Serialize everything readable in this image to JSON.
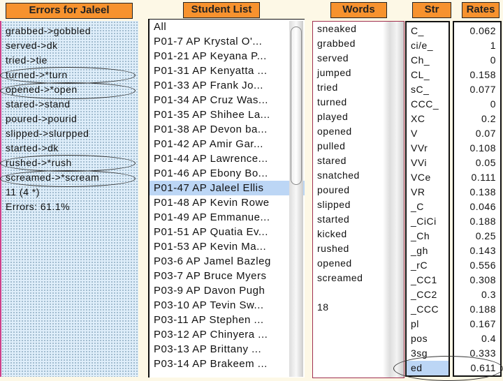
{
  "errors": {
    "title": "Errors for Jaleel",
    "lines": [
      "grabbed->gobbled",
      "served->dk",
      "tried->tie",
      "turned->*turn",
      "opened->*open",
      "stared->stand",
      "poured->pourid",
      "slipped->slurpped",
      "started->dk",
      "rushed->*rush",
      "screamed->*scream",
      "11 (4 *)",
      "Errors: 61.1%"
    ]
  },
  "students": {
    "title": "Student List",
    "selected": "P01-47 AP Jaleel Ellis",
    "items": [
      "All",
      "P01-7 AP Krystal O'...",
      "P01-21 AP Keyana P...",
      "P01-31 AP Kenyatta ...",
      "P01-33 AP Frank Jo...",
      "P01-34 AP Cruz Was...",
      "P01-35 AP Shihee La...",
      "P01-38 AP Devon ba...",
      "P01-42 AP Amir Gar...",
      "P01-44 AP Lawrence...",
      "P01-46 AP Ebony Bo...",
      "P01-47 AP Jaleel Ellis",
      "P01-48 AP Kevin Rowe",
      "P01-49 AP Emmanue...",
      "P01-51 AP Quatia Ev...",
      "P01-53 AP Kevin Ma...",
      "P03-6 AP Jamel Bazleg",
      "P03-7 AP Bruce Myers",
      "P03-9 AP Davon Pugh",
      "P03-10 AP Tevin Sw...",
      "P03-11 AP Stephen ...",
      "P03-12 AP Chinyera ...",
      "P03-13 AP Brittany ...",
      "P03-14 AP Brakeem ..."
    ]
  },
  "words": {
    "title": "Words",
    "items": [
      "sneaked",
      "grabbed",
      "served",
      "jumped",
      "tried",
      "turned",
      "played",
      "opened",
      "pulled",
      "stared",
      "snatched",
      "poured",
      "slipped",
      "started",
      "kicked",
      "rushed",
      "opened",
      "screamed",
      "",
      "18"
    ]
  },
  "str": {
    "title": "Str",
    "selected": "ed",
    "items": [
      "C_",
      "ci/e_",
      "Ch_",
      "CL_",
      "sC_",
      "CCC_",
      "XC",
      "V",
      "VVr",
      "VVi",
      "VCe",
      "VR",
      "_C",
      "_CiCi",
      "_Ch",
      "_gh",
      "_rC",
      "_CC1",
      "_CC2",
      "_CCC",
      "pl",
      "pos",
      "3sg",
      "ed"
    ]
  },
  "rates": {
    "title": "Rates",
    "items": [
      "0.062",
      "1",
      "0",
      "0.158",
      "0.077",
      "0",
      "0.2",
      "0.07",
      "0.108",
      "0.05",
      "0.111",
      "0.138",
      "0.046",
      "0.188",
      "0.25",
      "0.143",
      "0.556",
      "0.308",
      "0.3",
      "0.188",
      "0.167",
      "0.4",
      "0.333",
      "0.611"
    ]
  },
  "colors": {
    "header": "#f7922e",
    "selection": "#bcd6f5"
  }
}
